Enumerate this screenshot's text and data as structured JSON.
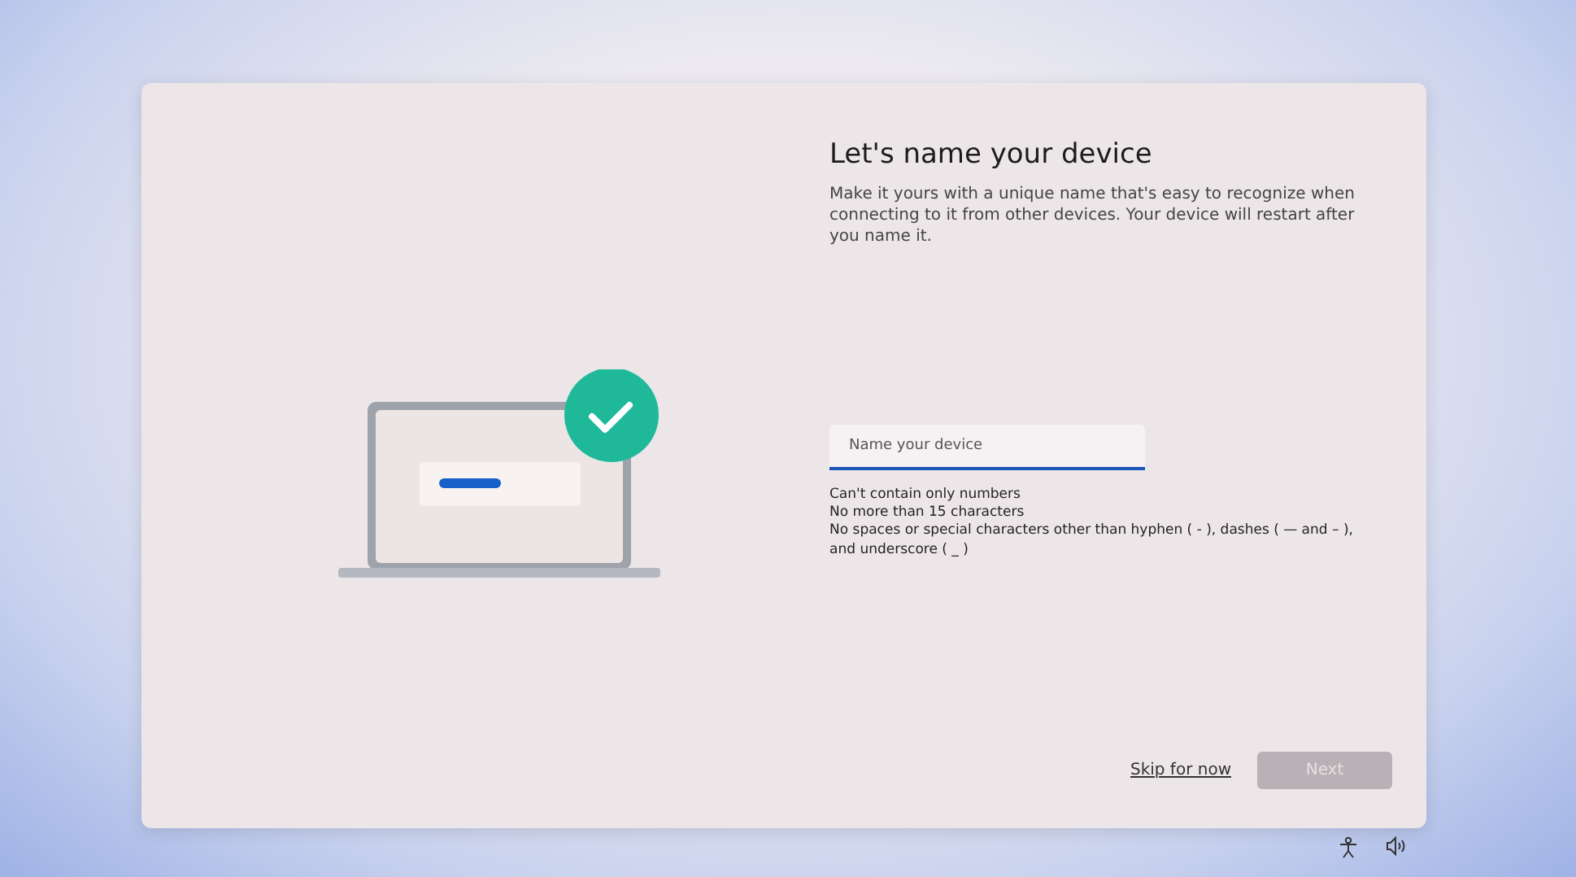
{
  "title": "Let's name your device",
  "description": "Make it yours with a unique name that's easy to recognize when connecting to it from other devices. Your device will restart after you name it.",
  "name_field": {
    "placeholder": "Name your device"
  },
  "rules": [
    "Can't contain only numbers",
    "No more than 15 characters",
    "No spaces or special characters other than hyphen ( - ), dashes ( — and – ), and underscore ( _ )"
  ],
  "skip_link": "Skip for now",
  "next_button": {
    "label": "Next",
    "disabled": true
  }
}
